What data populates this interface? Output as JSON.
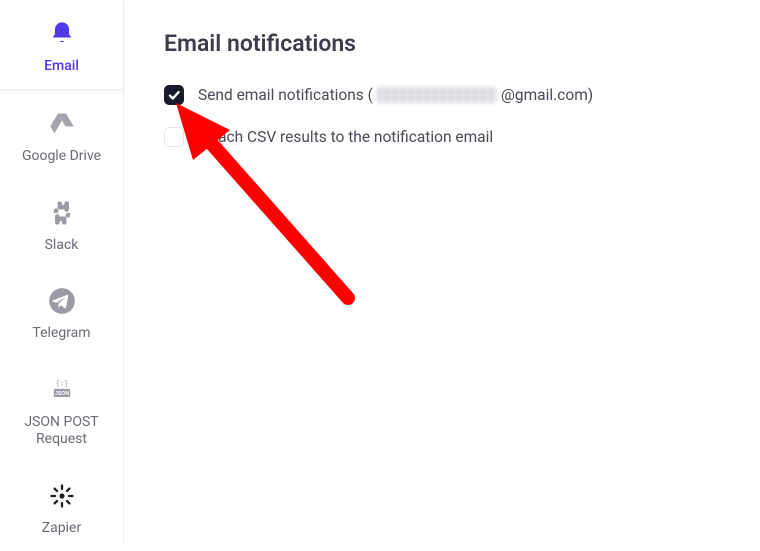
{
  "sidebar": {
    "items": [
      {
        "label": "Email",
        "icon": "bell-icon",
        "active": true
      },
      {
        "label": "Google Drive",
        "icon": "google-drive-icon",
        "active": false
      },
      {
        "label": "Slack",
        "icon": "slack-icon",
        "active": false
      },
      {
        "label": "Telegram",
        "icon": "telegram-icon",
        "active": false
      },
      {
        "label": "JSON POST Request",
        "icon": "json-icon",
        "active": false
      },
      {
        "label": "Zapier",
        "icon": "zapier-icon",
        "active": false
      }
    ]
  },
  "main": {
    "title": "Email notifications",
    "options": [
      {
        "checked": true,
        "label_prefix": "Send email notifications (",
        "label_blurred": true,
        "label_suffix": "@gmail.com)"
      },
      {
        "checked": false,
        "label": "Attach CSV results to the notification email"
      }
    ]
  },
  "annotation": {
    "arrow_color": "#ff0000"
  }
}
